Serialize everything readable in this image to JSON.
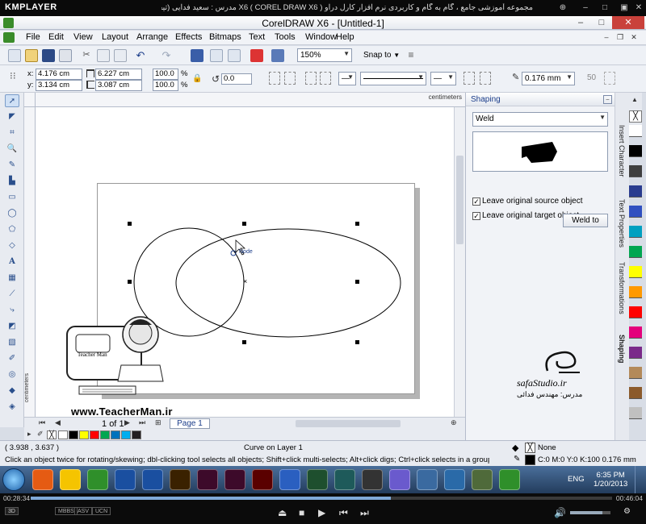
{
  "kmplayer": {
    "logo": "KMPLAYER",
    "title": "مجموعه آموزشی جامع ، گام به گام و کاربردی نرم افزار کارل دراو X6 ( COREL DRAW X6 )   مدرس : سعید فدایی (تیچرمن) گروه آموزشی پادشاه گرافیست ها",
    "elapsed": "00:28:34",
    "total": "00:46:04",
    "progress": 0.62,
    "badges": [
      "3D",
      "MBBS",
      "ASV",
      "UCN"
    ]
  },
  "window": {
    "title": "CorelDRAW X6 - [Untitled-1]"
  },
  "menu": [
    "File",
    "Edit",
    "View",
    "Layout",
    "Arrange",
    "Effects",
    "Bitmaps",
    "Text",
    "Tools",
    "Window",
    "Help"
  ],
  "toolbar": {
    "zoom": "150%",
    "snap": "Snap to"
  },
  "propbar": {
    "x_label": "x:",
    "x": "4.176 cm",
    "y_label": "y:",
    "y": "3.134 cm",
    "w": "6.227 cm",
    "h": "3.087 cm",
    "sx": "100.0",
    "sy": "100.0",
    "pct": "%",
    "angle": "0.0",
    "outline": "0.176 mm",
    "scale": "50"
  },
  "ruler": {
    "top_unit": "centimeters",
    "left_unit": "centimeters"
  },
  "canvas": {
    "node_label": "Node",
    "teacherman_url": "www.TeacherMan.ir",
    "teacherman_text": "Teacher Man"
  },
  "page_nav": {
    "current": "1",
    "of": "of",
    "total": "1",
    "tab": "Page 1"
  },
  "palette_swatches": [
    "#ffffff",
    "#000000",
    "#ffff00",
    "#ff0000",
    "#00a651",
    "#0072bc",
    "#00aeef",
    "#231f20"
  ],
  "docker": {
    "title": "Shaping",
    "mode": "Weld",
    "chk1": "Leave original source object",
    "chk2": "Leave original target object",
    "button": "Weld to"
  },
  "side_tabs": [
    "Insert Character",
    "Text Properties",
    "Transformations",
    "Shaping"
  ],
  "color_palette": [
    "#ffffff",
    "#000000",
    "#3f3f3f",
    "#2a3c8f",
    "#3050c0",
    "#00a0c0",
    "#00a651",
    "#ffff00",
    "#ff9900",
    "#ff0000",
    "#e4007c",
    "#7a2a8a",
    "#b38a5a",
    "#8b5a2b",
    "#c0c0c0"
  ],
  "watermark": {
    "safa_name": "safaStudio.ir",
    "safa_sub": "مدرس: مهندس فدائی"
  },
  "status": {
    "coords": "( 3.938 , 3.637 )",
    "object": "Curve on Layer 1",
    "hint": "Click an object twice for rotating/skewing; dbl-clicking tool selects all objects; Shift+click multi-selects; Alt+click digs; Ctrl+click selects in a group",
    "fill": "None",
    "outline": "C:0 M:0 Y:0 K:100  0.176 mm"
  },
  "taskbar": {
    "apps": [
      "Firefox",
      "Star",
      "CorelDRAW",
      "Ps",
      "Ps",
      "Ai",
      "Id",
      "Id",
      "Fl",
      "Search",
      "App",
      "App",
      "App",
      "Media",
      "Explorer",
      "App",
      "App",
      "CorelDRAW"
    ],
    "lang": "ENG",
    "time": "6:35 PM",
    "date": "1/20/2013"
  }
}
